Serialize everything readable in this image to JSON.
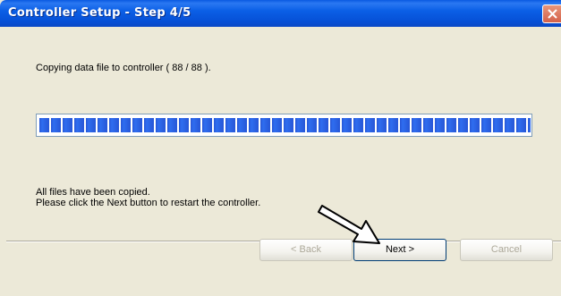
{
  "window": {
    "title": "Controller Setup - Step 4/5",
    "close_icon": "close-icon"
  },
  "progress": {
    "status_text": "Copying data file to controller ( 88 / 88 ).",
    "value": 88,
    "max": 88,
    "fill_color": "#2f6ef0"
  },
  "messages": {
    "line1": "All files have been copied.",
    "line2": "Please click the Next button to restart the controller."
  },
  "buttons": {
    "back_label": "< Back",
    "next_label": "Next >",
    "cancel_label": "Cancel"
  },
  "cursor": {
    "icon": "arrow-cursor-icon"
  }
}
